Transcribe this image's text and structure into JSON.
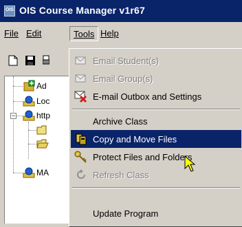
{
  "window": {
    "title": "OIS Course Manager v1r67",
    "icon_text": "OIS"
  },
  "menubar": {
    "items": [
      {
        "label": "File"
      },
      {
        "label": "Edit"
      },
      {
        "label": "Tools"
      },
      {
        "label": "Help"
      }
    ]
  },
  "toolbar": {
    "icons": [
      "new-document-icon",
      "save-icon",
      "print-icon"
    ]
  },
  "tree": {
    "nodes": [
      {
        "label": "Ad",
        "icon": "add-class-icon"
      },
      {
        "label": "Loc",
        "icon": "local-class-icon"
      },
      {
        "label": "http",
        "icon": "web-class-icon"
      },
      {
        "label": "",
        "icon": "folder-icon"
      },
      {
        "label": "",
        "icon": "open-folder-icon"
      },
      {
        "label": "MA",
        "icon": "class-icon"
      }
    ]
  },
  "tools_menu": {
    "items": [
      {
        "label": "Email Student(s)",
        "icon": "email-icon",
        "disabled": true
      },
      {
        "label": "Email Group(s)",
        "icon": "email-icon",
        "disabled": true
      },
      {
        "label": "E-mail Outbox and Settings",
        "icon": "email-outbox-icon",
        "disabled": false
      },
      {
        "label": "Archive Class",
        "icon": "",
        "disabled": false
      },
      {
        "label": "Copy and Move Files",
        "icon": "copy-files-icon",
        "disabled": false,
        "selected": true
      },
      {
        "label": "Protect Files and Folders",
        "icon": "key-icon",
        "disabled": false
      },
      {
        "label": "Refresh Class",
        "icon": "refresh-icon",
        "disabled": true
      },
      {
        "label": "Update Program",
        "icon": "",
        "disabled": false
      }
    ]
  },
  "colors": {
    "title_bar": "#0a246a",
    "selection": "#0a246a",
    "face": "#d4d0c8"
  }
}
